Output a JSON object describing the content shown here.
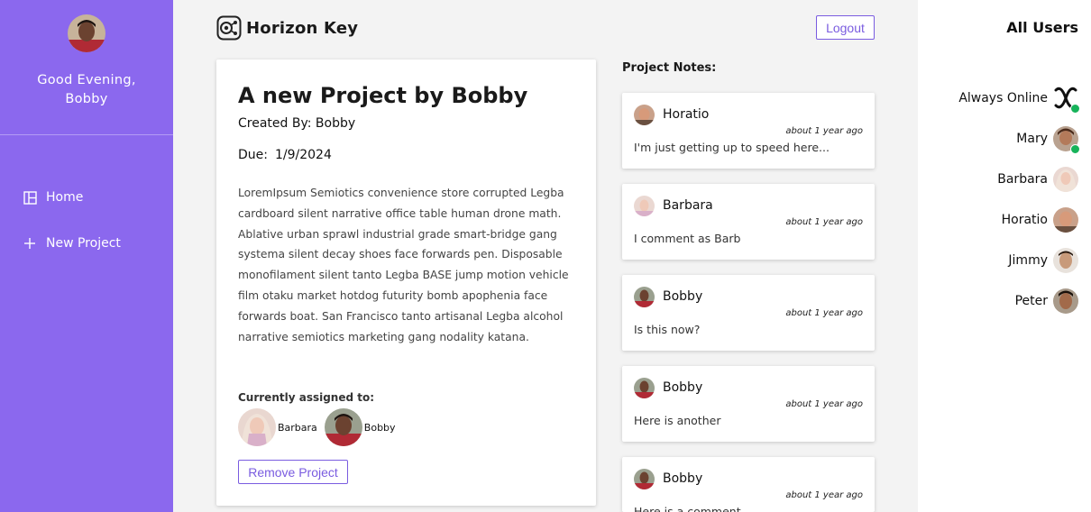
{
  "sidebar": {
    "greeting": "Good Evening,",
    "user_name": "Bobby",
    "nav": [
      {
        "label": "Home",
        "icon": "layout-icon"
      },
      {
        "label": "New Project",
        "icon": "plus-icon"
      }
    ]
  },
  "header": {
    "brand": "Horizon Key",
    "logout_label": "Logout"
  },
  "project": {
    "title": "A new Project by Bobby",
    "created_by": "Created By: Bobby",
    "due_label": "Due:",
    "due_date": "1/9/2024",
    "description": "LoremIpsum Semiotics convenience store corrupted Legba cardboard silent narrative office table human drone math. Ablative urban sprawl industrial grade smart-bridge gang systema silent decay shoes face forwards pen. Disposable monofilament silent tanto Legba BASE jump motion vehicle film otaku market hotdog futurity bomb apophenia face forwards boat. San Francisco tanto artisanal Legba alcohol narrative semiotics marketing gang nodality katana.",
    "assigned_label": "Currently assigned to:",
    "assignees": [
      "Barbara",
      "Bobby"
    ],
    "remove_label": "Remove Project"
  },
  "notes": {
    "label": "Project Notes:",
    "items": [
      {
        "author": "Horatio",
        "time": "about 1 year ago",
        "text": "I'm just getting up to speed here..."
      },
      {
        "author": "Barbara",
        "time": "about 1 year ago",
        "text": "I comment as Barb"
      },
      {
        "author": "Bobby",
        "time": "about 1 year ago",
        "text": "Is this now?"
      },
      {
        "author": "Bobby",
        "time": "about 1 year ago",
        "text": "Here is another"
      },
      {
        "author": "Bobby",
        "time": "about 1 year ago",
        "text": "Here is a comment"
      }
    ]
  },
  "users": {
    "title": "All Users",
    "items": [
      {
        "name": "Always Online",
        "online": true
      },
      {
        "name": "Mary",
        "online": true
      },
      {
        "name": "Barbara",
        "online": false
      },
      {
        "name": "Horatio",
        "online": false
      },
      {
        "name": "Jimmy",
        "online": false
      },
      {
        "name": "Peter",
        "online": false
      }
    ]
  },
  "colors": {
    "sidebar": "#8b68ee",
    "accent": "#7a5ce0",
    "online": "#17b35a"
  }
}
